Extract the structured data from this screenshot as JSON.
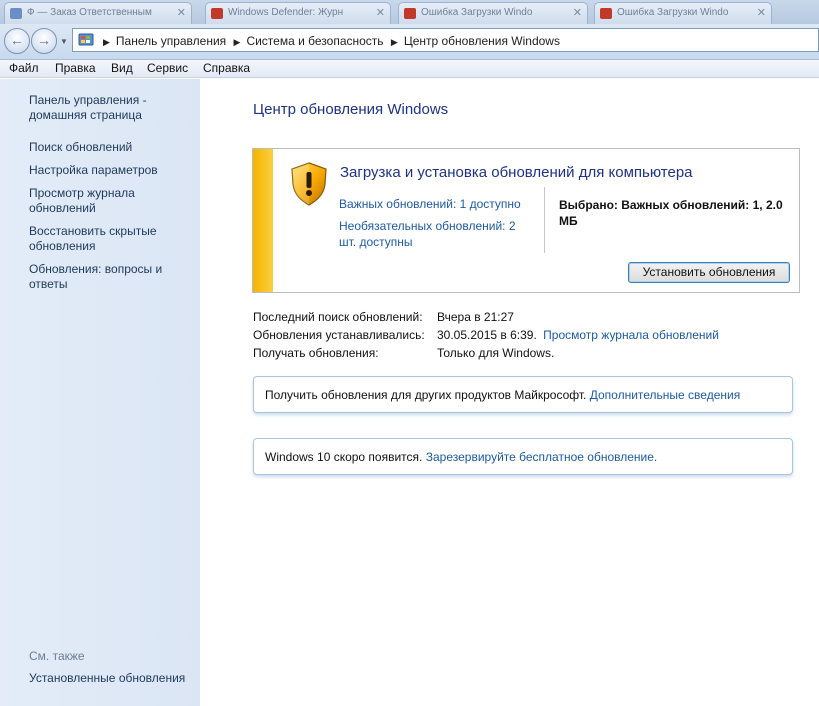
{
  "tabs": [
    {
      "label": "Ф — Заказ Ответственным",
      "color": "#6a8fc4"
    },
    {
      "label": "Windows Defender: Журн",
      "color": "#c0392b"
    },
    {
      "label": "Ошибка Загрузки Windo",
      "color": "#c0392b"
    },
    {
      "label": "Ошибка Загрузки Windo",
      "color": "#c0392b"
    }
  ],
  "navigation": {
    "back_glyph": "←",
    "forward_glyph": "→",
    "breadcrumbs": [
      "Панель управления",
      "Система и безопасность",
      "Центр обновления Windows"
    ]
  },
  "menu": [
    "Файл",
    "Правка",
    "Вид",
    "Сервис",
    "Справка"
  ],
  "sidebar": {
    "home": "Панель управления - домашняя страница",
    "items": [
      "Поиск обновлений",
      "Настройка параметров",
      "Просмотр журнала обновлений",
      "Восстановить скрытые обновления",
      "Обновления: вопросы и ответы"
    ],
    "see_also": "См. также",
    "installed": "Установленные обновления"
  },
  "main": {
    "title": "Центр обновления Windows",
    "box": {
      "title": "Загрузка и установка обновлений для компьютера",
      "important_link": "Важных обновлений: 1 доступно",
      "optional_link": "Необязательных обновлений: 2 шт. доступны",
      "selected": "Выбрано: Важных обновлений: 1, 2.0 МБ",
      "install_button": "Установить обновления",
      "accent_color": "#f4b400"
    },
    "info": {
      "last_search_label": "Последний поиск обновлений:",
      "last_search_value": "Вчера в 21:27",
      "installed_label": "Обновления устанавливались:",
      "installed_value": "30.05.2015 в 6:39.",
      "history_link": "Просмотр журнала обновлений",
      "receive_label": "Получать обновления:",
      "receive_value": "Только для Windows."
    },
    "notice1": {
      "text": "Получить обновления для других продуктов Майкрософт.",
      "link": "Дополнительные сведения"
    },
    "notice2": {
      "text": "Windows 10 скоро появится.",
      "link": "Зарезервируйте бесплатное обновление."
    }
  }
}
